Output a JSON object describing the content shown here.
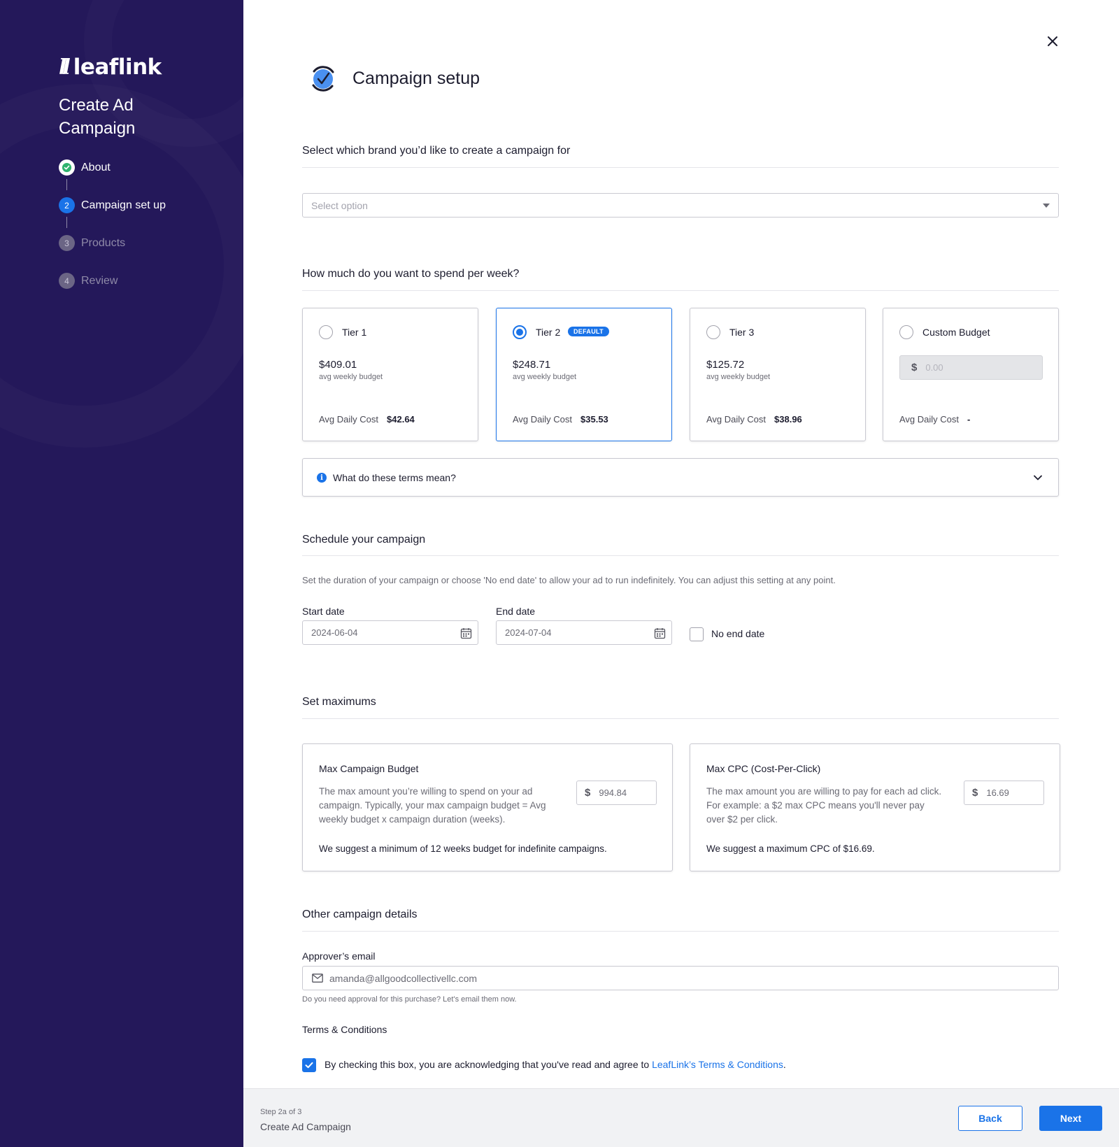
{
  "sidebar": {
    "logo": "leaflink",
    "logo_mark": "ll",
    "title": "Create Ad Campaign",
    "steps": [
      {
        "number": "1",
        "label": "About",
        "state": "done"
      },
      {
        "number": "2",
        "label": "Campaign set up",
        "state": "active"
      },
      {
        "number": "3",
        "label": "Products",
        "state": "future"
      },
      {
        "number": "4",
        "label": "Review",
        "state": "future"
      }
    ]
  },
  "header": {
    "title": "Campaign setup"
  },
  "brand": {
    "heading": "Select which brand you’d like to create a campaign for",
    "placeholder": "Select option"
  },
  "spend": {
    "heading": "How much do you want to spend per week?",
    "tiers": [
      {
        "name": "Tier 1",
        "amount": "$409.01",
        "sub": "avg weekly budget",
        "daily_label": "Avg Daily Cost",
        "daily_value": "$42.64",
        "selected": false
      },
      {
        "name": "Tier 2",
        "badge": "DEFAULT",
        "amount": "$248.71",
        "sub": "avg weekly budget",
        "daily_label": "Avg Daily Cost",
        "daily_value": "$35.53",
        "selected": true
      },
      {
        "name": "Tier 3",
        "amount": "$125.72",
        "sub": "avg weekly budget",
        "daily_label": "Avg Daily Cost",
        "daily_value": "$38.96",
        "selected": false
      },
      {
        "name": "Custom Budget",
        "currency": "$",
        "placeholder": "0.00",
        "daily_label": "Avg Daily Cost",
        "daily_value": "-",
        "selected": false
      }
    ],
    "terms_question": "What do these terms mean?"
  },
  "schedule": {
    "heading": "Schedule your campaign",
    "description": "Set the duration of your campaign or choose 'No end date' to allow your ad to run indefinitely. You can adjust this setting at any point.",
    "start_label": "Start date",
    "start_value": "2024-06-04",
    "end_label": "End date",
    "end_value": "2024-07-04",
    "no_end_label": "No end date",
    "no_end_checked": false
  },
  "maximums": {
    "heading": "Set maximums",
    "budget": {
      "title": "Max Campaign Budget",
      "description": "The max amount you’re willing to spend on your ad campaign. Typically, your max campaign budget = Avg weekly budget x campaign duration (weeks).",
      "currency": "$",
      "value": "994.84",
      "note": "We suggest a minimum of 12 weeks budget for indefinite campaigns."
    },
    "cpc": {
      "title": "Max CPC (Cost-Per-Click)",
      "description": "The max amount you are willing to pay for each ad click. For example: a $2 max CPC means you'll never pay over $2 per click.",
      "currency": "$",
      "value": "16.69",
      "note": "We suggest a maximum CPC of $16.69."
    }
  },
  "other": {
    "heading": "Other campaign details",
    "email_label": "Approver’s email",
    "email_value": "amanda@allgoodcollectivellc.com",
    "email_help": "Do you need approval for this purchase? Let's email them now.",
    "terms_heading": "Terms & Conditions",
    "terms_text": "By checking this box, you are acknowledging that you've read and agree to ",
    "terms_link": "LeafLink’s Terms & Conditions",
    "terms_end": ".",
    "terms_checked": true
  },
  "footer": {
    "step_of": "Step 2a of 3",
    "title": "Create Ad Campaign",
    "back_label": "Back",
    "next_label": "Next"
  },
  "colors": {
    "sidebar_bg": "#24185a",
    "accent": "#1a73e8",
    "success": "#2fb36e"
  }
}
